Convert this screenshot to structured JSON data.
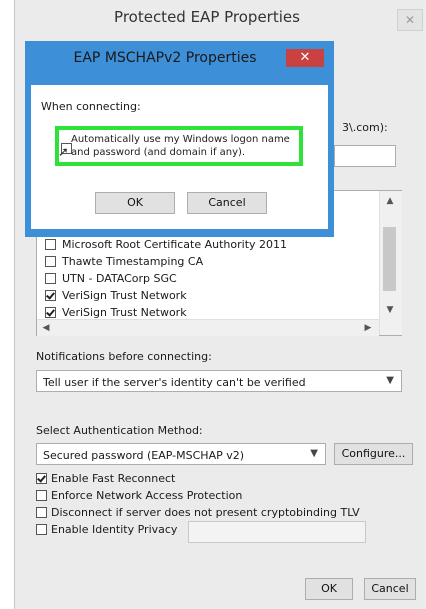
{
  "main": {
    "title": "Protected EAP Properties",
    "server_fragment": "3\\.com):",
    "cert_list": {
      "items": [
        {
          "label": "Microsoft Root Certificate Authority 2011",
          "checked": false
        },
        {
          "label": "Thawte Timestamping CA",
          "checked": false
        },
        {
          "label": "UTN - DATACorp SGC",
          "checked": false
        },
        {
          "label": "VeriSign Trust Network",
          "checked": true
        },
        {
          "label": "VeriSign Trust Network",
          "checked": true
        }
      ]
    },
    "notifications_label": "Notifications before connecting:",
    "notifications_value": "Tell user if the server's identity can't be verified",
    "auth_method_label": "Select Authentication Method:",
    "auth_method_value": "Secured password (EAP-MSCHAP v2)",
    "configure_label": "Configure...",
    "options": [
      {
        "label": "Enable Fast Reconnect",
        "checked": true
      },
      {
        "label": "Enforce Network Access Protection",
        "checked": false
      },
      {
        "label": "Disconnect if server does not present cryptobinding TLV",
        "checked": false
      },
      {
        "label": "Enable Identity Privacy",
        "checked": false
      }
    ],
    "ok_label": "OK",
    "cancel_label": "Cancel"
  },
  "sub": {
    "title": "EAP MSCHAPv2 Properties",
    "when_connecting_label": "When connecting:",
    "auto_logon_label": "Automatically use my Windows logon name and password (and domain if any).",
    "auto_logon_checked": false,
    "ok_label": "OK",
    "cancel_label": "Cancel"
  },
  "colors": {
    "dialog_bg": "#ebebeb",
    "overlay_frame": "#3d8fd8",
    "close_red": "#c94141",
    "highlight_green": "#2fe23a"
  }
}
